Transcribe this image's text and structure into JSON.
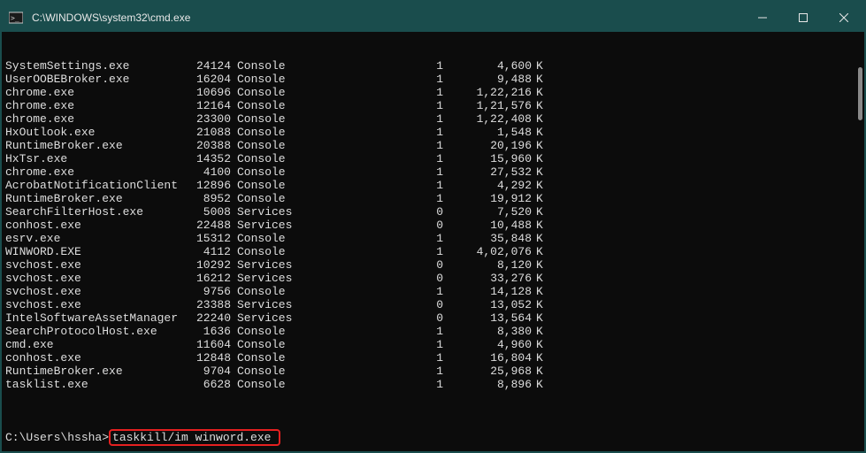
{
  "window": {
    "title": "C:\\WINDOWS\\system32\\cmd.exe",
    "icon_name": "cmd-icon"
  },
  "processes": [
    {
      "name": "SystemSettings.exe",
      "pid": "24124",
      "session_name": "Console",
      "session_id": "1",
      "mem": "4,600",
      "unit": "K"
    },
    {
      "name": "UserOOBEBroker.exe",
      "pid": "16204",
      "session_name": "Console",
      "session_id": "1",
      "mem": "9,488",
      "unit": "K"
    },
    {
      "name": "chrome.exe",
      "pid": "10696",
      "session_name": "Console",
      "session_id": "1",
      "mem": "1,22,216",
      "unit": "K"
    },
    {
      "name": "chrome.exe",
      "pid": "12164",
      "session_name": "Console",
      "session_id": "1",
      "mem": "1,21,576",
      "unit": "K"
    },
    {
      "name": "chrome.exe",
      "pid": "23300",
      "session_name": "Console",
      "session_id": "1",
      "mem": "1,22,408",
      "unit": "K"
    },
    {
      "name": "HxOutlook.exe",
      "pid": "21088",
      "session_name": "Console",
      "session_id": "1",
      "mem": "1,548",
      "unit": "K"
    },
    {
      "name": "RuntimeBroker.exe",
      "pid": "20388",
      "session_name": "Console",
      "session_id": "1",
      "mem": "20,196",
      "unit": "K"
    },
    {
      "name": "HxTsr.exe",
      "pid": "14352",
      "session_name": "Console",
      "session_id": "1",
      "mem": "15,960",
      "unit": "K"
    },
    {
      "name": "chrome.exe",
      "pid": "4100",
      "session_name": "Console",
      "session_id": "1",
      "mem": "27,532",
      "unit": "K"
    },
    {
      "name": "AcrobatNotificationClient",
      "pid": "12896",
      "session_name": "Console",
      "session_id": "1",
      "mem": "4,292",
      "unit": "K"
    },
    {
      "name": "RuntimeBroker.exe",
      "pid": "8952",
      "session_name": "Console",
      "session_id": "1",
      "mem": "19,912",
      "unit": "K"
    },
    {
      "name": "SearchFilterHost.exe",
      "pid": "5008",
      "session_name": "Services",
      "session_id": "0",
      "mem": "7,520",
      "unit": "K"
    },
    {
      "name": "conhost.exe",
      "pid": "22488",
      "session_name": "Services",
      "session_id": "0",
      "mem": "10,488",
      "unit": "K"
    },
    {
      "name": "esrv.exe",
      "pid": "15312",
      "session_name": "Console",
      "session_id": "1",
      "mem": "35,848",
      "unit": "K"
    },
    {
      "name": "WINWORD.EXE",
      "pid": "4112",
      "session_name": "Console",
      "session_id": "1",
      "mem": "4,02,076",
      "unit": "K"
    },
    {
      "name": "svchost.exe",
      "pid": "10292",
      "session_name": "Services",
      "session_id": "0",
      "mem": "8,120",
      "unit": "K"
    },
    {
      "name": "svchost.exe",
      "pid": "16212",
      "session_name": "Services",
      "session_id": "0",
      "mem": "33,276",
      "unit": "K"
    },
    {
      "name": "svchost.exe",
      "pid": "9756",
      "session_name": "Console",
      "session_id": "1",
      "mem": "14,128",
      "unit": "K"
    },
    {
      "name": "svchost.exe",
      "pid": "23388",
      "session_name": "Services",
      "session_id": "0",
      "mem": "13,052",
      "unit": "K"
    },
    {
      "name": "IntelSoftwareAssetManager",
      "pid": "22240",
      "session_name": "Services",
      "session_id": "0",
      "mem": "13,564",
      "unit": "K"
    },
    {
      "name": "SearchProtocolHost.exe",
      "pid": "1636",
      "session_name": "Console",
      "session_id": "1",
      "mem": "8,380",
      "unit": "K"
    },
    {
      "name": "cmd.exe",
      "pid": "11604",
      "session_name": "Console",
      "session_id": "1",
      "mem": "4,960",
      "unit": "K"
    },
    {
      "name": "conhost.exe",
      "pid": "12848",
      "session_name": "Console",
      "session_id": "1",
      "mem": "16,804",
      "unit": "K"
    },
    {
      "name": "RuntimeBroker.exe",
      "pid": "9704",
      "session_name": "Console",
      "session_id": "1",
      "mem": "25,968",
      "unit": "K"
    },
    {
      "name": "tasklist.exe",
      "pid": "6628",
      "session_name": "Console",
      "session_id": "1",
      "mem": "8,896",
      "unit": "K"
    }
  ],
  "prompt": {
    "path": "C:\\Users\\hssha>",
    "command": "taskkill/im winword.exe"
  }
}
